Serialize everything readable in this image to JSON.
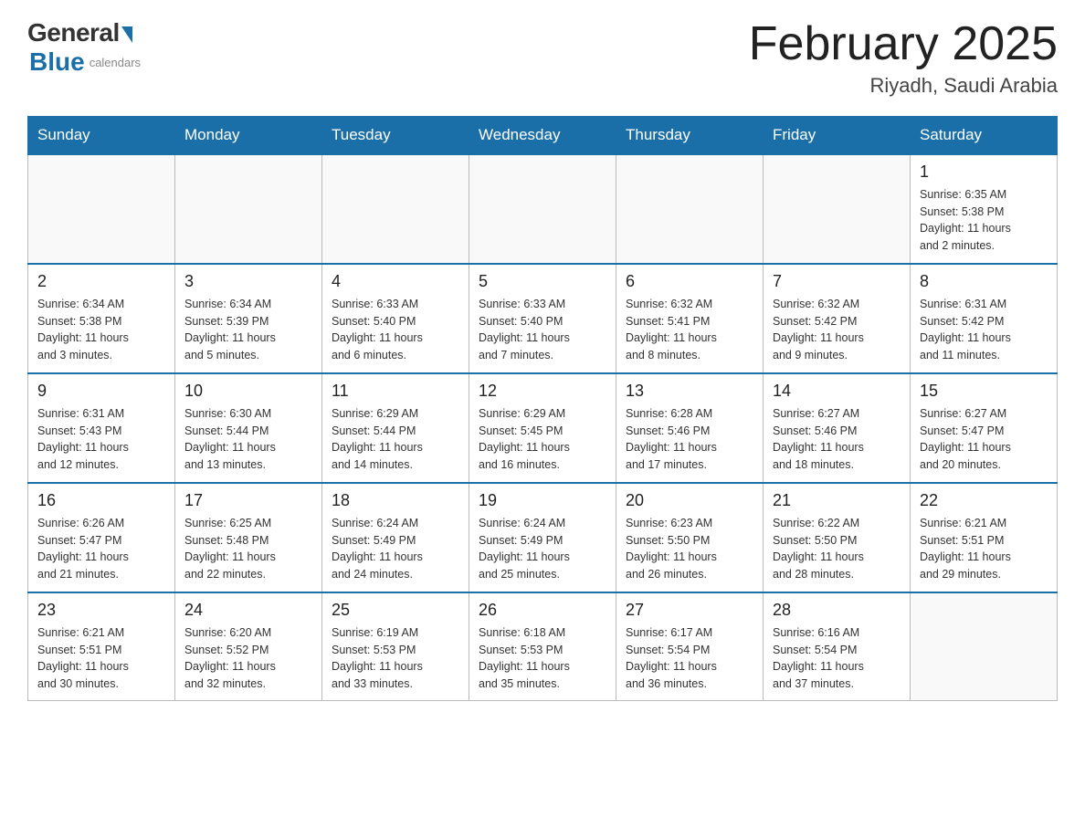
{
  "header": {
    "logo": {
      "general": "General",
      "blue": "Blue",
      "sub": "calendars"
    },
    "title": "February 2025",
    "location": "Riyadh, Saudi Arabia"
  },
  "days_of_week": [
    "Sunday",
    "Monday",
    "Tuesday",
    "Wednesday",
    "Thursday",
    "Friday",
    "Saturday"
  ],
  "weeks": [
    [
      {
        "day": "",
        "info": ""
      },
      {
        "day": "",
        "info": ""
      },
      {
        "day": "",
        "info": ""
      },
      {
        "day": "",
        "info": ""
      },
      {
        "day": "",
        "info": ""
      },
      {
        "day": "",
        "info": ""
      },
      {
        "day": "1",
        "info": "Sunrise: 6:35 AM\nSunset: 5:38 PM\nDaylight: 11 hours\nand 2 minutes."
      }
    ],
    [
      {
        "day": "2",
        "info": "Sunrise: 6:34 AM\nSunset: 5:38 PM\nDaylight: 11 hours\nand 3 minutes."
      },
      {
        "day": "3",
        "info": "Sunrise: 6:34 AM\nSunset: 5:39 PM\nDaylight: 11 hours\nand 5 minutes."
      },
      {
        "day": "4",
        "info": "Sunrise: 6:33 AM\nSunset: 5:40 PM\nDaylight: 11 hours\nand 6 minutes."
      },
      {
        "day": "5",
        "info": "Sunrise: 6:33 AM\nSunset: 5:40 PM\nDaylight: 11 hours\nand 7 minutes."
      },
      {
        "day": "6",
        "info": "Sunrise: 6:32 AM\nSunset: 5:41 PM\nDaylight: 11 hours\nand 8 minutes."
      },
      {
        "day": "7",
        "info": "Sunrise: 6:32 AM\nSunset: 5:42 PM\nDaylight: 11 hours\nand 9 minutes."
      },
      {
        "day": "8",
        "info": "Sunrise: 6:31 AM\nSunset: 5:42 PM\nDaylight: 11 hours\nand 11 minutes."
      }
    ],
    [
      {
        "day": "9",
        "info": "Sunrise: 6:31 AM\nSunset: 5:43 PM\nDaylight: 11 hours\nand 12 minutes."
      },
      {
        "day": "10",
        "info": "Sunrise: 6:30 AM\nSunset: 5:44 PM\nDaylight: 11 hours\nand 13 minutes."
      },
      {
        "day": "11",
        "info": "Sunrise: 6:29 AM\nSunset: 5:44 PM\nDaylight: 11 hours\nand 14 minutes."
      },
      {
        "day": "12",
        "info": "Sunrise: 6:29 AM\nSunset: 5:45 PM\nDaylight: 11 hours\nand 16 minutes."
      },
      {
        "day": "13",
        "info": "Sunrise: 6:28 AM\nSunset: 5:46 PM\nDaylight: 11 hours\nand 17 minutes."
      },
      {
        "day": "14",
        "info": "Sunrise: 6:27 AM\nSunset: 5:46 PM\nDaylight: 11 hours\nand 18 minutes."
      },
      {
        "day": "15",
        "info": "Sunrise: 6:27 AM\nSunset: 5:47 PM\nDaylight: 11 hours\nand 20 minutes."
      }
    ],
    [
      {
        "day": "16",
        "info": "Sunrise: 6:26 AM\nSunset: 5:47 PM\nDaylight: 11 hours\nand 21 minutes."
      },
      {
        "day": "17",
        "info": "Sunrise: 6:25 AM\nSunset: 5:48 PM\nDaylight: 11 hours\nand 22 minutes."
      },
      {
        "day": "18",
        "info": "Sunrise: 6:24 AM\nSunset: 5:49 PM\nDaylight: 11 hours\nand 24 minutes."
      },
      {
        "day": "19",
        "info": "Sunrise: 6:24 AM\nSunset: 5:49 PM\nDaylight: 11 hours\nand 25 minutes."
      },
      {
        "day": "20",
        "info": "Sunrise: 6:23 AM\nSunset: 5:50 PM\nDaylight: 11 hours\nand 26 minutes."
      },
      {
        "day": "21",
        "info": "Sunrise: 6:22 AM\nSunset: 5:50 PM\nDaylight: 11 hours\nand 28 minutes."
      },
      {
        "day": "22",
        "info": "Sunrise: 6:21 AM\nSunset: 5:51 PM\nDaylight: 11 hours\nand 29 minutes."
      }
    ],
    [
      {
        "day": "23",
        "info": "Sunrise: 6:21 AM\nSunset: 5:51 PM\nDaylight: 11 hours\nand 30 minutes."
      },
      {
        "day": "24",
        "info": "Sunrise: 6:20 AM\nSunset: 5:52 PM\nDaylight: 11 hours\nand 32 minutes."
      },
      {
        "day": "25",
        "info": "Sunrise: 6:19 AM\nSunset: 5:53 PM\nDaylight: 11 hours\nand 33 minutes."
      },
      {
        "day": "26",
        "info": "Sunrise: 6:18 AM\nSunset: 5:53 PM\nDaylight: 11 hours\nand 35 minutes."
      },
      {
        "day": "27",
        "info": "Sunrise: 6:17 AM\nSunset: 5:54 PM\nDaylight: 11 hours\nand 36 minutes."
      },
      {
        "day": "28",
        "info": "Sunrise: 6:16 AM\nSunset: 5:54 PM\nDaylight: 11 hours\nand 37 minutes."
      },
      {
        "day": "",
        "info": ""
      }
    ]
  ]
}
